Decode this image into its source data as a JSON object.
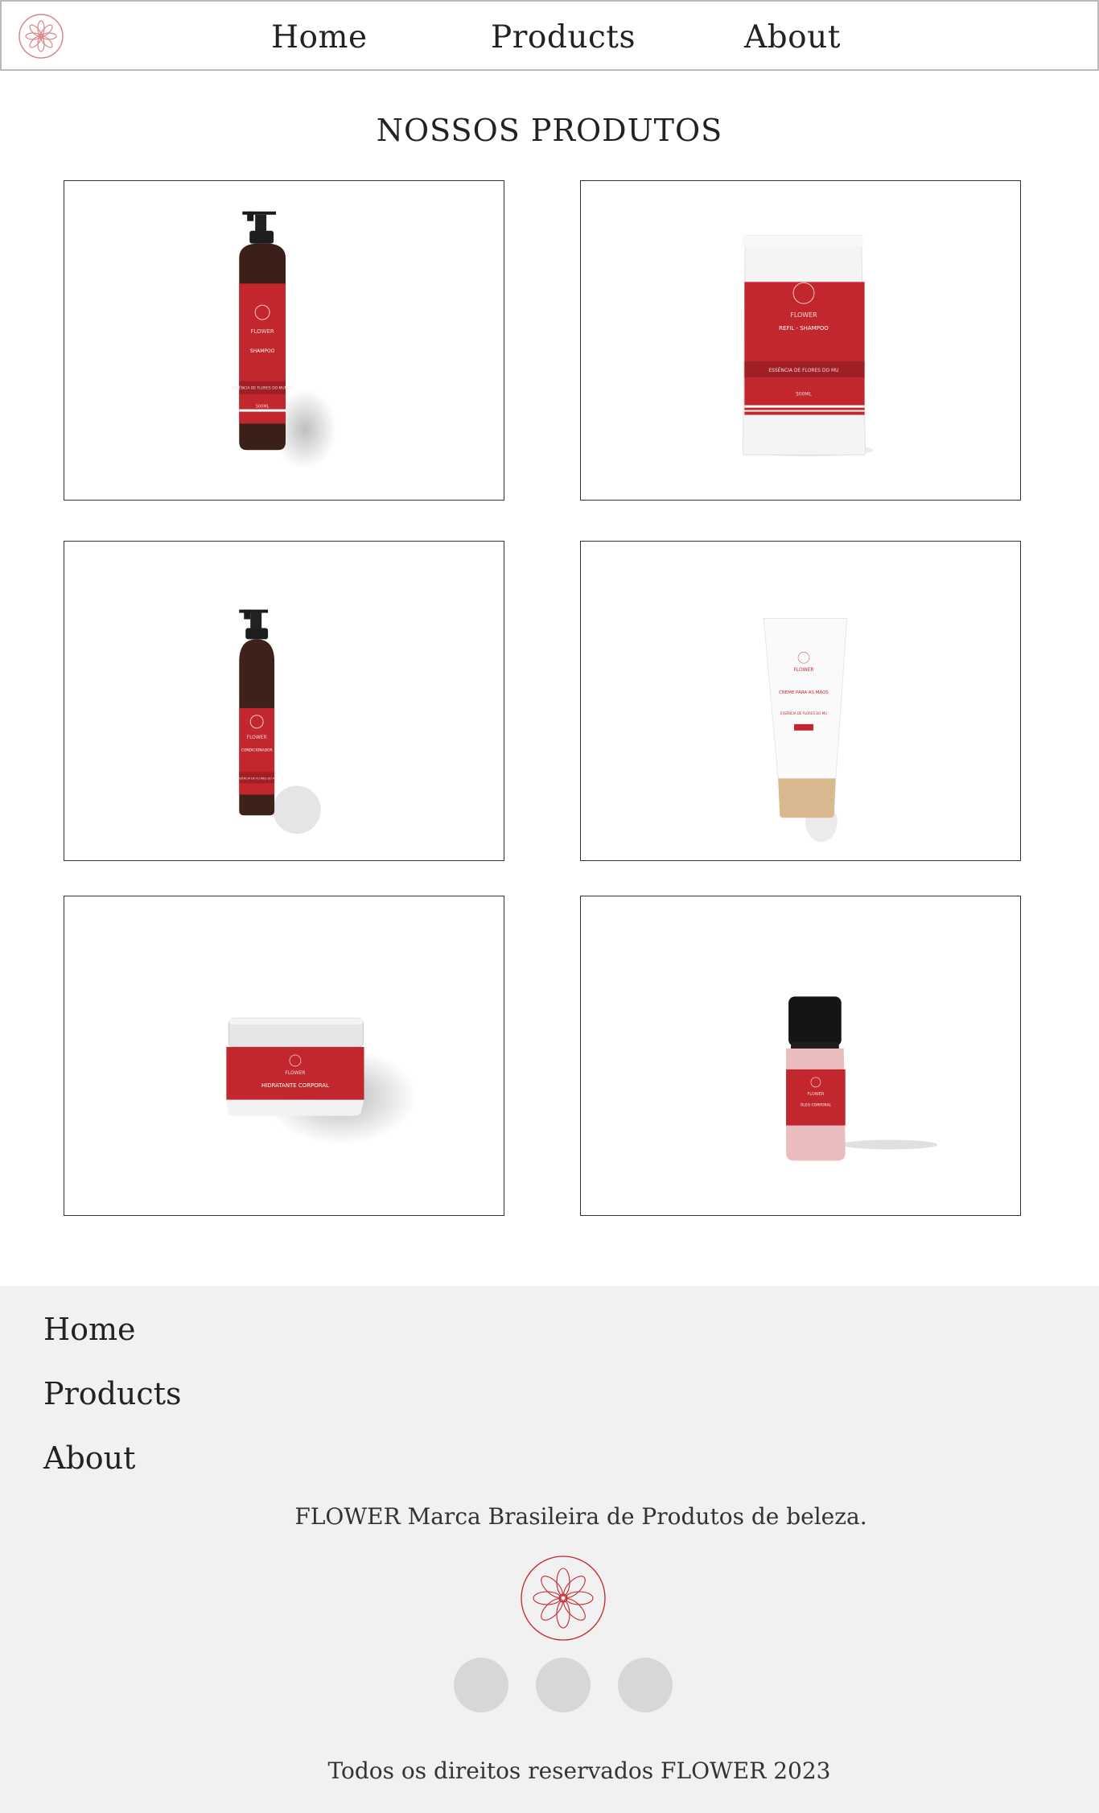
{
  "header": {
    "logo_icon": "flower-logo-icon",
    "nav": [
      {
        "label": "Home"
      },
      {
        "label": "Products"
      },
      {
        "label": "About"
      }
    ]
  },
  "main": {
    "title": "NOSSOS PRODUTOS",
    "products": [
      {
        "icon": "shampoo-pump-bottle-image",
        "brand": "FLOWER",
        "name": "SHAMPOO",
        "line": "ESSÊNCIA DE FLORES DO MUNDO",
        "size": "500ML"
      },
      {
        "icon": "refill-pouch-image",
        "brand": "FLOWER",
        "name": "REFIL - SHAMPOO",
        "line": "ESSÊNCIA DE FLORES DO MU",
        "size": "500ML"
      },
      {
        "icon": "conditioner-pump-bottle-image",
        "brand": "FLOWER",
        "name": "CONDICIONADOR",
        "line": "ESSÊNCIA DE FLORES DO MU"
      },
      {
        "icon": "hand-cream-tube-image",
        "brand": "FLOWER",
        "name": "CREME PARA AS MÃOS",
        "line": "ESSÊNCIA DE FLORES DO MU"
      },
      {
        "icon": "body-moisturizer-jar-image",
        "brand": "FLOWER",
        "name": "HIDRATANTE CORPORAL"
      },
      {
        "icon": "body-oil-bottle-image",
        "brand": "FLOWER",
        "name": "ÓLEO CORPORAL"
      }
    ]
  },
  "footer": {
    "links": [
      {
        "label": "Home"
      },
      {
        "label": "Products"
      },
      {
        "label": "About"
      }
    ],
    "tagline": "FLOWER Marca Brasileira de Produtos de beleza.",
    "logo_icon": "flower-logo-icon",
    "social": [
      {
        "icon": "social-icon-1"
      },
      {
        "icon": "social-icon-2"
      },
      {
        "icon": "social-icon-3"
      }
    ],
    "copyright": "Todos os direitos reservados FLOWER 2023"
  },
  "colors": {
    "brand_red": "#c2272d",
    "footer_bg": "#f1f1f1",
    "social_circle": "#d7d7d7"
  }
}
